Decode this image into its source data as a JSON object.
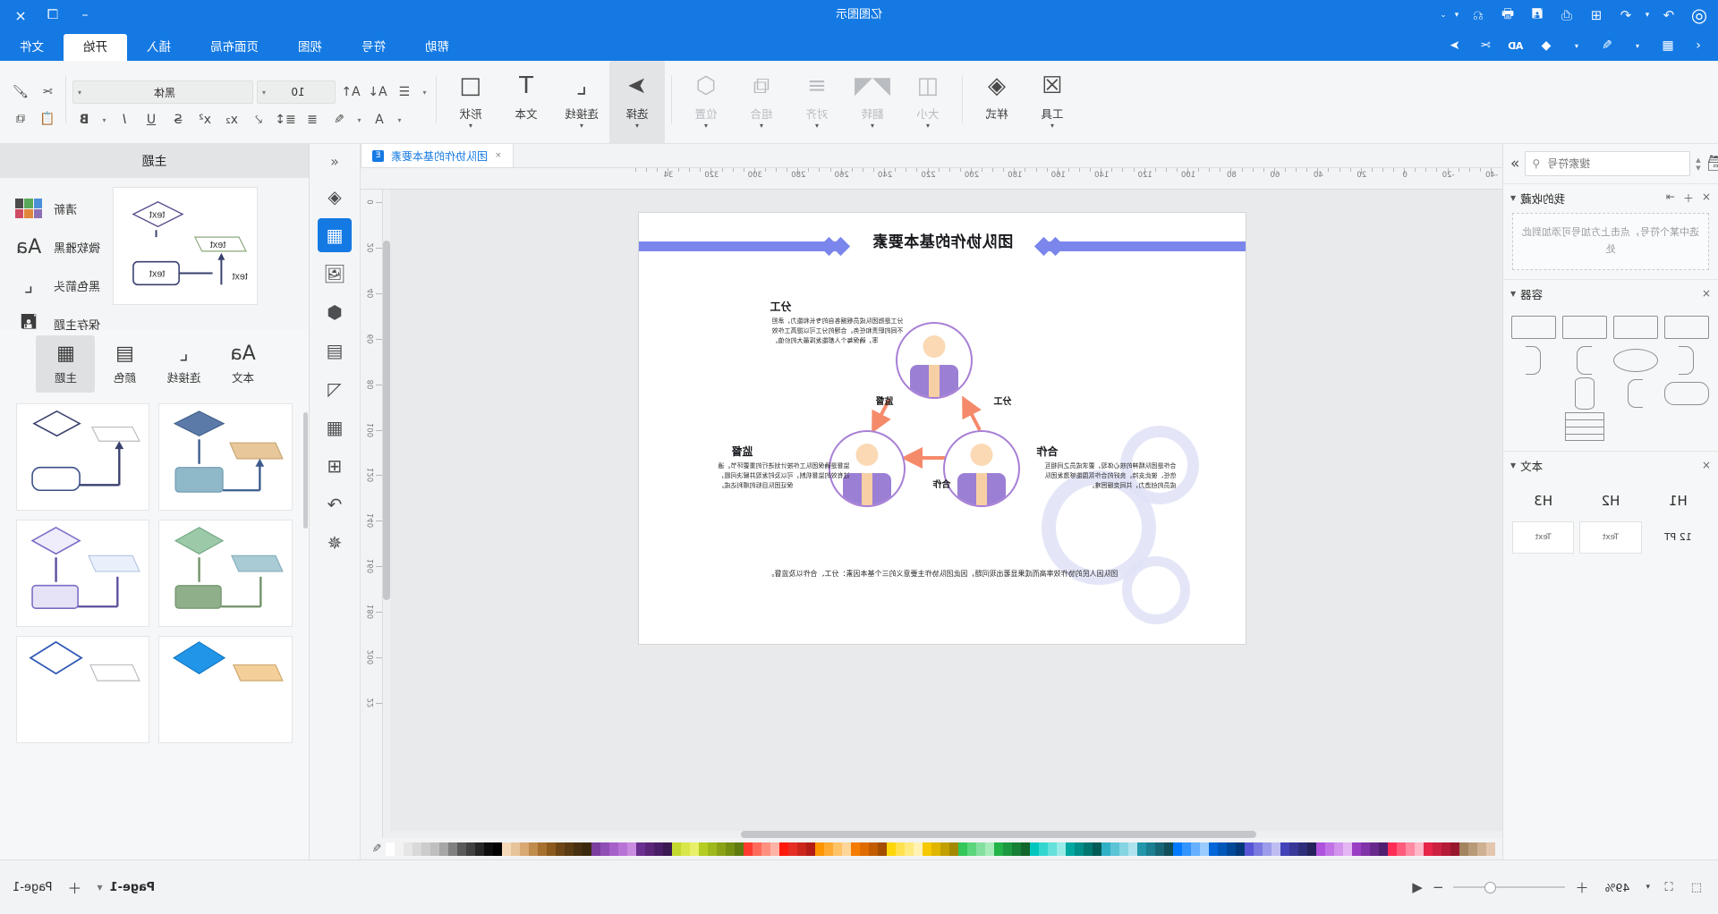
{
  "app": {
    "title": "亿图图示",
    "logo_icon": "edraw-logo-icon"
  },
  "titlebar": {
    "icons": [
      "undo-icon",
      "redo-dropdown-icon",
      "new-icon",
      "open-icon",
      "save-icon",
      "print-icon",
      "export-icon",
      "more-dropdown-icon"
    ],
    "minimize": "–",
    "maximize": "❐",
    "close": "×"
  },
  "quickaccess": {
    "items": [
      {
        "label": "↰",
        "name": "pointer-arrow-icon"
      },
      {
        "label": "✂",
        "name": "cut-icon"
      },
      {
        "label": "AD",
        "name": "ad-badge-icon"
      },
      {
        "label": "◆",
        "name": "diamond-icon"
      },
      {
        "label": "▦",
        "name": "grid-icon"
      },
      {
        "label": "⌃",
        "name": "collapse-ribbon-icon"
      }
    ]
  },
  "tabs": [
    {
      "label": "文件",
      "active": false
    },
    {
      "label": "开始",
      "active": true
    },
    {
      "label": "插入",
      "active": false
    },
    {
      "label": "页面布局",
      "active": false
    },
    {
      "label": "视图",
      "active": false
    },
    {
      "label": "符号",
      "active": false
    },
    {
      "label": "帮助",
      "active": false
    }
  ],
  "ribbon": {
    "groups": [
      {
        "items": [
          {
            "label": "形状",
            "icon": "□",
            "name": "shape-tool",
            "caret": true,
            "dim": false
          },
          {
            "label": "文本",
            "icon": "T",
            "name": "text-tool",
            "caret": false,
            "dim": false
          },
          {
            "label": "连接线",
            "icon": "⤵",
            "name": "connector-tool",
            "caret": true,
            "dim": false
          },
          {
            "label": "选择",
            "icon": "➤",
            "name": "select-tool",
            "caret": true,
            "dim": false,
            "selected": true
          }
        ]
      },
      {
        "items": [
          {
            "label": "位置",
            "icon": "⬡",
            "name": "position-tool",
            "caret": true,
            "dim": true
          },
          {
            "label": "组合",
            "icon": "⧉",
            "name": "group-tool",
            "caret": true,
            "dim": true
          },
          {
            "label": "对齐",
            "icon": "☰",
            "name": "align-tool",
            "caret": true,
            "dim": true
          },
          {
            "label": "翻转",
            "icon": "◬",
            "name": "flip-tool",
            "caret": true,
            "dim": true
          },
          {
            "label": "大小",
            "icon": "◱",
            "name": "size-tool",
            "caret": true,
            "dim": true
          }
        ]
      },
      {
        "items": [
          {
            "label": "样式",
            "icon": "◈",
            "name": "style-tool",
            "caret": false,
            "dim": false
          },
          {
            "label": "工具",
            "icon": "⌖",
            "name": "tools-tool",
            "caret": true,
            "dim": false
          }
        ]
      }
    ],
    "text": {
      "font_name": "黑体",
      "font_size": "10",
      "row1": [
        "increase-font-icon",
        "decrease-font-icon",
        "align-icon"
      ],
      "row2": [
        "bold-icon",
        "italic-icon",
        "underline-icon",
        "strikethrough-icon",
        "superscript-icon",
        "subscript-icon",
        "font-color-icon",
        "highlight-icon",
        "line-spacing-icon",
        "bullet-list-icon",
        "clear-format-icon"
      ],
      "copy_icon": "copy-icon",
      "paste_icon": "paste-icon",
      "format_painter_icon": "format-painter-icon",
      "cut_icon": "cut-icon"
    }
  },
  "theme_panel": {
    "title": "主题",
    "options": [
      {
        "label": "清新",
        "icon": "color-swatch-icon",
        "name": "theme-color-option"
      },
      {
        "label": "微软雅黑",
        "icon": "Aa",
        "name": "theme-font-option"
      },
      {
        "label": "黑色箭头",
        "icon": "⤵",
        "name": "theme-connector-option"
      },
      {
        "label": "保存主题",
        "icon": "ὋE",
        "name": "save-theme-option"
      }
    ],
    "swatch_colors": [
      "#4a90d9",
      "#5aa85a",
      "#4b4b4b",
      "#8d6fb5",
      "#e0873c",
      "#cf4a63"
    ],
    "tabs": [
      {
        "label": "主题",
        "icon": "▦",
        "active": true,
        "name": "tab-theme"
      },
      {
        "label": "颜色",
        "icon": "▤",
        "active": false,
        "name": "tab-color"
      },
      {
        "label": "连接线",
        "icon": "⤵",
        "active": false,
        "name": "tab-connector"
      },
      {
        "label": "本文",
        "icon": "Aa",
        "active": false,
        "name": "tab-text"
      }
    ]
  },
  "ministrip": {
    "collapse_icon": "«",
    "buttons": [
      {
        "icon": "◈",
        "name": "fill-icon",
        "active": false
      },
      {
        "icon": "▦",
        "name": "theme-grid-icon",
        "active": true
      },
      {
        "icon": "⛰",
        "name": "image-icon",
        "active": false
      },
      {
        "icon": "❖",
        "name": "layers-icon",
        "active": false
      },
      {
        "icon": "▤",
        "name": "container-icon",
        "active": false
      },
      {
        "icon": "◿",
        "name": "chart-icon",
        "active": false
      },
      {
        "icon": "▦",
        "name": "table-icon",
        "active": false
      },
      {
        "icon": "⊞",
        "name": "gallery-icon",
        "active": false
      },
      {
        "icon": "⎇",
        "name": "flow-icon",
        "active": false
      },
      {
        "icon": "✥",
        "name": "effects-icon",
        "active": false
      }
    ]
  },
  "document": {
    "tab_label": "图队协作的基本要素",
    "tab_title": "团队协作的基本要素",
    "close_icon": "×",
    "badge": "E"
  },
  "ruler": {
    "h_labels": [
      "-40",
      "-20",
      "0",
      "20",
      "40",
      "60",
      "80",
      "100",
      "120",
      "140",
      "160",
      "180",
      "200",
      "220",
      "240",
      "260",
      "280",
      "300",
      "320",
      "34"
    ],
    "v_labels": [
      "0",
      "20",
      "40",
      "60",
      "80",
      "100",
      "120",
      "140",
      "160",
      "180",
      "200",
      "22"
    ]
  },
  "page_content": {
    "title": "团队协作的基本要素",
    "nodes": [
      {
        "key": "fengong",
        "label": "分工"
      },
      {
        "key": "jiandu",
        "label": "监督"
      },
      {
        "key": "hezuo",
        "label": "合作"
      }
    ],
    "sections": [
      {
        "heading": "分工",
        "body": "分工是指团队成员根据各自的专长和能力，承担不同的职责和任务。合理的分工可以提高工作效率，确保每个人都能发挥最大的价值。"
      },
      {
        "heading": "监督",
        "body": "监督是确保团队工作按计划进行的重要环节。通过有效的监督机制，可以及时发现并解决问题，保证团队目标的顺利达成。"
      },
      {
        "heading": "合作",
        "body": "合作是团队精神的核心体现，要求成员之间相互信任、彼此支持。良好的合作氛围能够激发团队成员的创造力，共同克服困难。"
      }
    ],
    "footnote": "团队因人民的协作效率高而成果显著出现问题，因此团队协作主要意义的三个基本因素：分工、合作以及监督。"
  },
  "shapes_panel": {
    "search": {
      "placeholder": "搜索符号",
      "value": "",
      "icon": "search-icon",
      "folder_icon": "library-icon",
      "up_icon": "▲",
      "down_icon": "▼"
    },
    "collapse_icon": "»",
    "sections": [
      {
        "title": "我的收藏",
        "name": "favorites-section",
        "caret": "▼",
        "actions": [
          "↱",
          "＋",
          "×"
        ],
        "empty_text": "选中某个符号，点击上方加号可添加到此处"
      },
      {
        "title": "容器",
        "name": "container-section",
        "caret": "▼",
        "actions": [
          "×"
        ],
        "shapes": [
          "rect",
          "rect",
          "rounded",
          "rect",
          "bracket-right",
          "bracket-left",
          "bracket-right",
          "ellipse",
          "cylinder",
          "bracket-wide",
          "bracket-left",
          "table",
          "table-grid"
        ]
      },
      {
        "title": "本文",
        "name": "text-section",
        "caret": "▼",
        "actions": [
          "×"
        ],
        "cells": [
          "H1",
          "H2",
          "H3",
          "12 PT",
          "Text",
          "Text"
        ]
      }
    ]
  },
  "statusbar": {
    "page_label": "Page-1",
    "page_caret": "▼",
    "add_page": "＋",
    "tab_label": "Page-1",
    "play_icon": "◀",
    "zoom_out": "−",
    "zoom_in": "＋",
    "zoom_value": "49%",
    "zoom_caret": "▾",
    "fit_icon": "⛶",
    "fullscreen_icon": "⬚"
  },
  "palette": {
    "colors": [
      "#ffffff",
      "#f2f2f2",
      "#e6e6e6",
      "#d9d9d9",
      "#cccccc",
      "#bfbfbf",
      "#a6a6a6",
      "#808080",
      "#595959",
      "#404040",
      "#262626",
      "#0d0d0d",
      "#000000",
      "#f5d9b8",
      "#e8c49a",
      "#d9a873",
      "#c08c4e",
      "#a6702f",
      "#8c5a1e",
      "#6e4516",
      "#5a3a12",
      "#46300f",
      "#3a2a0d",
      "#7b3fa0",
      "#8f4fb5",
      "#a660c9",
      "#b873d6",
      "#c98ce0",
      "#6b2f8f",
      "#5a2578",
      "#4a1e66",
      "#3b1852",
      "#c4d92f",
      "#d8e64a",
      "#e8f06a",
      "#b5cc22",
      "#9fb81c",
      "#8aa316",
      "#758f12",
      "#607a0e",
      "#ff3b30",
      "#ff6b5a",
      "#ff9080",
      "#ffb3a6",
      "#ff1a0d",
      "#e62e24",
      "#cc251c",
      "#b31d15",
      "#ff9500",
      "#ffaa33",
      "#ffc266",
      "#ffd699",
      "#f57c00",
      "#e06b00",
      "#c25c00",
      "#a34d00",
      "#ffd60a",
      "#ffe14d",
      "#ffea80",
      "#fff2b3",
      "#f5c800",
      "#e0b600",
      "#c2a000",
      "#a38800",
      "#34c759",
      "#5cd67c",
      "#85e09f",
      "#a8ebbb",
      "#22b349",
      "#1c9940",
      "#168036",
      "#10662b",
      "#00c7be",
      "#33d6ce",
      "#66e0da",
      "#99ebe7",
      "#00a8a1",
      "#008f89",
      "#007670",
      "#005c57",
      "#30b0c7",
      "#5bc4d6",
      "#85d4e3",
      "#aee2ed",
      "#2296ab",
      "#1c7e91",
      "#166676",
      "#104e5a",
      "#007aff",
      "#3394ff",
      "#66b0ff",
      "#99cbff",
      "#0066d9",
      "#0057b8",
      "#004799",
      "#00387a",
      "#5856d6",
      "#7a79e0",
      "#9c9beb",
      "#bebdf2",
      "#4342b8",
      "#383799",
      "#2e2d7a",
      "#24235c",
      "#af52de",
      "#c173e6",
      "#d394ed",
      "#e5b6f4",
      "#9a3ec4",
      "#8133a8",
      "#68298c",
      "#501f70",
      "#ff2d55",
      "#ff5c7c",
      "#ff8aa2",
      "#ffb8c8",
      "#e62548",
      "#cc203f",
      "#b31b36",
      "#99172d",
      "#a2845e",
      "#b89a78",
      "#ceb093",
      "#e4c6ae"
    ],
    "picker_icon": "eyedropper-icon"
  }
}
